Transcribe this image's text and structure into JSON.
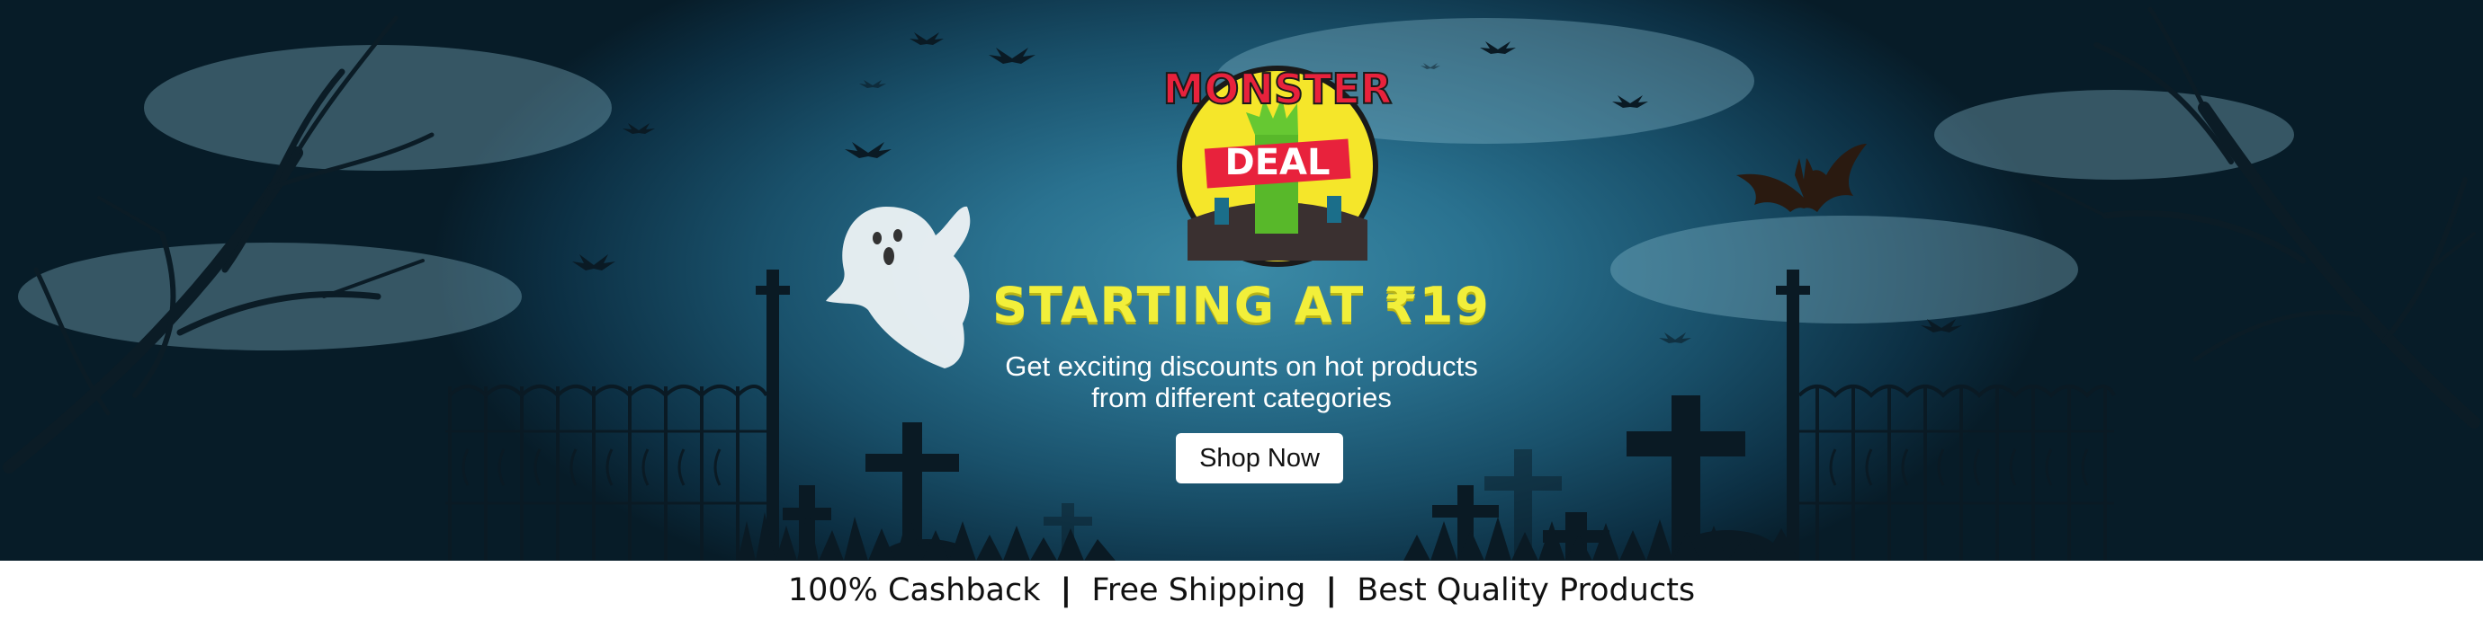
{
  "banner": {
    "logo": {
      "top_word": "MONSTER",
      "sign_word": "DEAL"
    },
    "headline": "STARTING AT ₹19",
    "description_line1": "Get exciting discounts on hot products",
    "description_line2": "from different categories",
    "cta_label": "Shop Now",
    "colors": {
      "headline": "#f2ef3a",
      "background": "#2a7290",
      "logo_circle": "#f5e62a",
      "logo_text": "#e8223c"
    }
  },
  "features": {
    "item1": "100% Cashback",
    "separator": "|",
    "item2": "Free Shipping",
    "item3": "Best Quality Products"
  }
}
